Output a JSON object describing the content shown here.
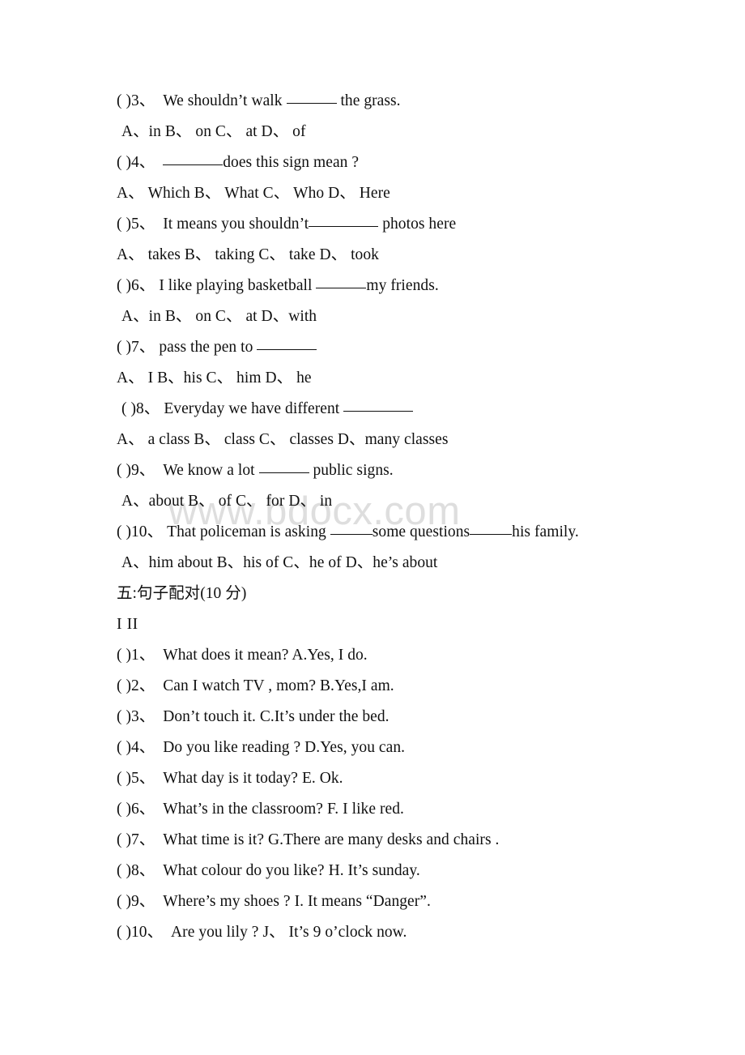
{
  "document": {
    "watermark": "www.bdocx.com",
    "watermark_color": "#dedede",
    "text_color": "#101010",
    "background_color": "#ffffff"
  },
  "multiple_choice": {
    "items": [
      {
        "marker": "( )3、",
        "stem_before": "We shouldn’t walk",
        "blank": "______",
        "stem_after": "the grass.",
        "options": "A、in B、 on C、  at D、  of"
      },
      {
        "marker": "( )4、",
        "stem_before": "",
        "blank": "________",
        "stem_after": "does this sign mean ?",
        "options": "A、  Which B、 What C、  Who D、 Here"
      },
      {
        "marker": "( )5、",
        "stem_before": "It means you shouldn’t",
        "blank": "_________",
        "stem_after": "photos here",
        "options": "A、  takes B、  taking C、 take D、  took"
      },
      {
        "marker": "( )6、",
        "stem_before": "I like playing basketball",
        "blank": "______",
        "stem_after": "my friends.",
        "options": "A、in B、  on C、  at D、with"
      },
      {
        "marker": "( )7、",
        "stem_before": "pass the pen to",
        "blank": "________",
        "stem_after": "",
        "options": "A、  I B、his C、 him D、 he"
      },
      {
        "marker": "( )8、",
        "stem_before": "Everyday we have different",
        "blank": "__________",
        "stem_after": "",
        "options": "A、  a class B、  class C、 classes D、many classes"
      },
      {
        "marker": "( )9、",
        "stem_before": "We know a lot",
        "blank": "______",
        "stem_after": "public signs.",
        "options": "A、about B、 of C、 for D、  in"
      },
      {
        "marker": "( )10、",
        "stem_before": "That policeman is asking",
        "blank": "_____",
        "stem_mid": "some questions",
        "blank2": "_____",
        "stem_after": "his family.",
        "options": "A、him about B、his of C、he of D、he’s about"
      }
    ]
  },
  "matching_section": {
    "heading": "五:句子配对(10 分)",
    "columns_label": "I II",
    "items": [
      {
        "marker": "( )1、",
        "left": "What does it mean?",
        "right": "A.Yes, I do."
      },
      {
        "marker": "( )2、",
        "left": "Can I watch TV , mom?",
        "right": "B.Yes,I am."
      },
      {
        "marker": "( )3、",
        "left": "Don’t touch it.",
        "right": "C.It’s under the bed."
      },
      {
        "marker": "( )4、",
        "left": "Do you like reading ?",
        "right": "D.Yes, you can."
      },
      {
        "marker": "( )5、",
        "left": "What day is it today?",
        "right": "E. Ok."
      },
      {
        "marker": "( )6、",
        "left": "What’s in the classroom?",
        "right": "F. I like red."
      },
      {
        "marker": "( )7、",
        "left": "What time is it?",
        "right": "G.There are many desks and chairs ."
      },
      {
        "marker": "( )8、",
        "left": "What colour do you like?",
        "right": "H. It’s sunday."
      },
      {
        "marker": "( )9、",
        "left": "Where’s my shoes ?",
        "right": "I. It means “Danger”."
      },
      {
        "marker": "( )10、",
        "left": "Are you lily ?",
        "right": "J、  It’s 9 o’clock now."
      }
    ]
  }
}
